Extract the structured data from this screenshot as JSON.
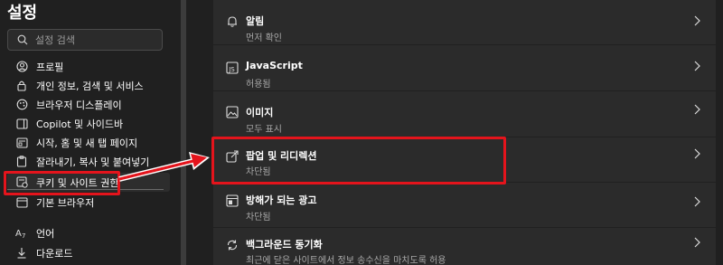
{
  "sidebar": {
    "title": "설정",
    "search_placeholder": "설정 검색",
    "items": [
      {
        "label": "프로필",
        "icon": "profile-icon"
      },
      {
        "label": "개인 정보, 검색 및 서비스",
        "icon": "lock-icon"
      },
      {
        "label": "브라우저 디스플레이",
        "icon": "display-icon"
      },
      {
        "label": "Copilot 및 사이드바",
        "icon": "sidebar-icon"
      },
      {
        "label": "시작, 홈 및 새 탭 페이지",
        "icon": "home-icon"
      },
      {
        "label": "잘라내기, 복사 및 붙여넣기",
        "icon": "clipboard-icon"
      },
      {
        "label": "쿠키 및 사이트 권한",
        "icon": "cookie-icon"
      },
      {
        "label": "기본 브라우저",
        "icon": "browser-icon"
      },
      {
        "label": "언어",
        "icon": "language-icon"
      },
      {
        "label": "다운로드",
        "icon": "download-icon"
      }
    ]
  },
  "settings": [
    {
      "title": "알림",
      "subtitle": "먼저 확인",
      "icon": "bell-icon"
    },
    {
      "title": "JavaScript",
      "subtitle": "허용됨",
      "icon": "javascript-icon"
    },
    {
      "title": "이미지",
      "subtitle": "모두 표시",
      "icon": "image-icon"
    },
    {
      "title": "팝업 및 리디렉션",
      "subtitle": "차단됨",
      "icon": "popup-icon"
    },
    {
      "title": "방해가 되는 광고",
      "subtitle": "차단됨",
      "icon": "ads-icon"
    },
    {
      "title": "백그라운드 동기화",
      "subtitle": "최근에 닫은 사이트에서 정보 송수신을 마치도록 허용",
      "icon": "sync-icon"
    }
  ],
  "colors": {
    "highlight": "#e4141c",
    "background": "#202020",
    "card": "#2b2b2b"
  }
}
